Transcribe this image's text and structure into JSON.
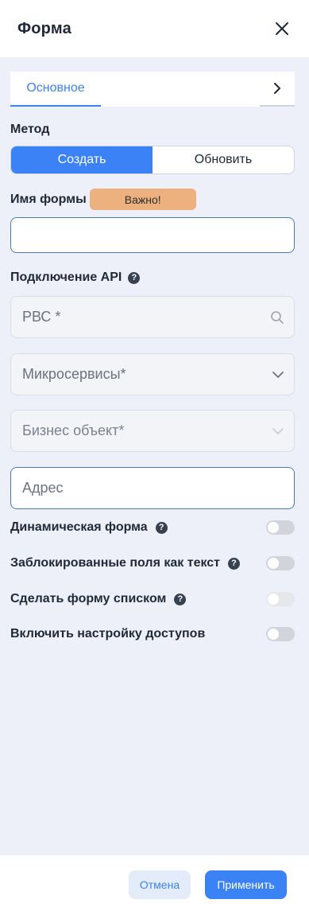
{
  "header": {
    "title": "Форма"
  },
  "tabs": [
    {
      "label": "Основное",
      "active": true
    }
  ],
  "method": {
    "label": "Метод",
    "options": [
      {
        "label": "Создать",
        "active": true
      },
      {
        "label": "Обновить",
        "active": false
      }
    ]
  },
  "form_name": {
    "label": "Имя формы",
    "badge": "Важно!",
    "value": ""
  },
  "api": {
    "label": "Подключение API",
    "rbs_placeholder": "РВС *",
    "microservices_placeholder": "Микросервисы*",
    "business_object_placeholder": "Бизнес объект*",
    "address_placeholder": "Адрес"
  },
  "toggles": [
    {
      "label": "Динамическая форма",
      "help": true,
      "on": false,
      "enabled": true
    },
    {
      "label": "Заблокированные поля как текст",
      "help": true,
      "on": false,
      "enabled": true
    },
    {
      "label": "Сделать форму списком",
      "help": true,
      "on": false,
      "enabled": false
    },
    {
      "label": "Включить настройку доступов",
      "help": false,
      "on": false,
      "enabled": true
    }
  ],
  "footer": {
    "cancel_label": "Отмена",
    "apply_label": "Применить"
  },
  "colors": {
    "accent": "#3b82f6",
    "badge": "#edb07f",
    "body_bg": "#eef0f9"
  }
}
